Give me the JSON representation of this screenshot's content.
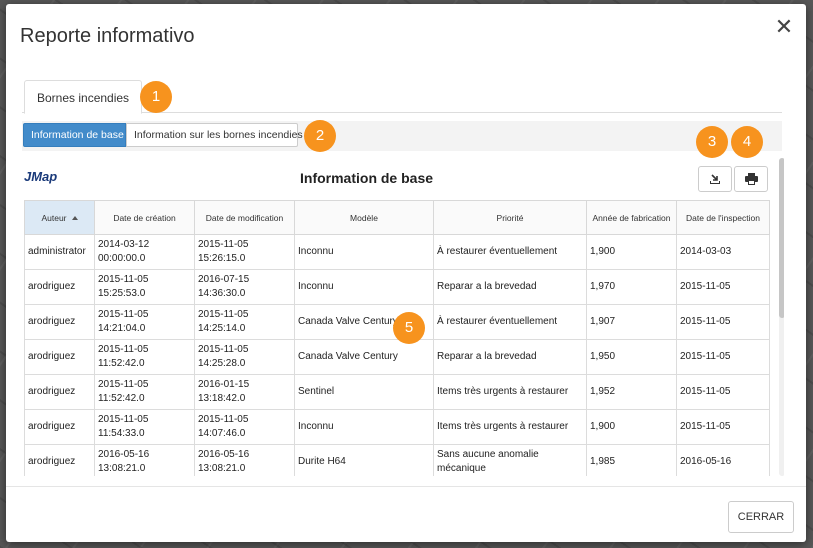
{
  "dialog": {
    "title": "Reporte informativo",
    "close_glyph": "✕"
  },
  "tabs": [
    {
      "label": "Bornes incendies"
    }
  ],
  "subtabs": [
    {
      "label": "Information de base",
      "active": true
    },
    {
      "label": "Information sur les bornes incendies",
      "active": false
    }
  ],
  "callouts": [
    "1",
    "2",
    "3",
    "4",
    "5"
  ],
  "report": {
    "logo": "JMap",
    "title": "Information de base",
    "export_icon": "export-icon",
    "print_icon": "printer-icon"
  },
  "table": {
    "columns": [
      "Auteur",
      "Date de création",
      "Date de modification",
      "Modèle",
      "Priorité",
      "Année de fabrication",
      "Date de l'inspection"
    ],
    "rows": [
      [
        "administrator",
        "2014-03-12\n00:00:00.0",
        "2015-11-05\n15:26:15.0",
        "Inconnu",
        "À restaurer éventuellement",
        "1,900",
        "2014-03-03"
      ],
      [
        "arodriguez",
        "2015-11-05\n15:25:53.0",
        "2016-07-15\n14:36:30.0",
        "Inconnu",
        "Reparar a la brevedad",
        "1,970",
        "2015-11-05"
      ],
      [
        "arodriguez",
        "2015-11-05\n14:21:04.0",
        "2015-11-05\n14:25:14.0",
        "Canada Valve Century",
        "À restaurer éventuellement",
        "1,907",
        "2015-11-05"
      ],
      [
        "arodriguez",
        "2015-11-05\n11:52:42.0",
        "2015-11-05\n14:25:28.0",
        "Canada Valve Century",
        "Reparar a la brevedad",
        "1,950",
        "2015-11-05"
      ],
      [
        "arodriguez",
        "2015-11-05\n11:52:42.0",
        "2016-01-15\n13:18:42.0",
        "Sentinel",
        "Items très urgents à restaurer",
        "1,952",
        "2015-11-05"
      ],
      [
        "arodriguez",
        "2015-11-05\n11:54:33.0",
        "2015-11-05\n14:07:46.0",
        "Inconnu",
        "Items très urgents à restaurer",
        "1,900",
        "2015-11-05"
      ],
      [
        "arodriguez",
        "2016-05-16\n13:08:21.0",
        "2016-05-16\n13:08:21.0",
        "Durite H64",
        "Sans aucune anomalie\nmécanique",
        "1,985",
        "2016-05-16"
      ]
    ]
  },
  "footer": {
    "close_label": "CERRAR"
  },
  "colors": {
    "accent": "#428bca",
    "callout": "#f7931e"
  }
}
